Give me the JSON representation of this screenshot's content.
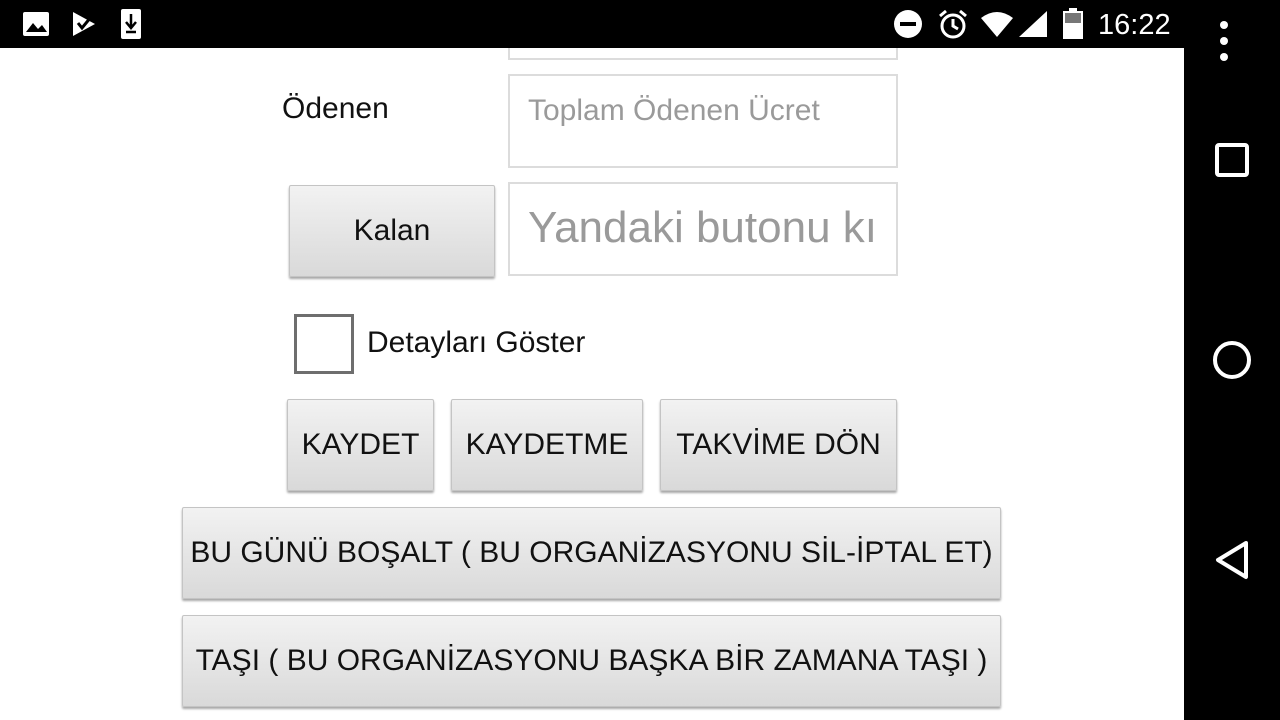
{
  "status_bar": {
    "time": "16:22",
    "left_icons": [
      "image-icon",
      "play-store-icon",
      "download-icon"
    ],
    "right_icons": [
      "do-not-disturb-icon",
      "alarm-icon",
      "wifi-icon",
      "signal-icon",
      "battery-icon"
    ]
  },
  "form": {
    "paid_label": "Ödenen",
    "paid_placeholder": "Toplam Ödenen Ücret",
    "remaining_button": "Kalan",
    "remaining_placeholder": "Yandaki butonu kı",
    "show_details_label": "Detayları Göster",
    "show_details_checked": false
  },
  "actions": {
    "save": "KAYDET",
    "dont_save": "KAYDETME",
    "back_to_calendar": "TAKVİME DÖN",
    "clear_day": "BU GÜNÜ BOŞALT ( BU ORGANİZASYONU SİL-İPTAL ET)",
    "move": "TAŞI ( BU ORGANİZASYONU BAŞKA BİR ZAMANA TAŞI )"
  },
  "nav_bar": [
    "overflow-menu-icon",
    "recents-icon",
    "home-icon",
    "back-icon"
  ],
  "colors": {
    "background": "#ffffff",
    "bar": "#000000",
    "button_top": "#f2f2f2",
    "button_bottom": "#d9d9d9",
    "placeholder": "#9a9a9a"
  }
}
